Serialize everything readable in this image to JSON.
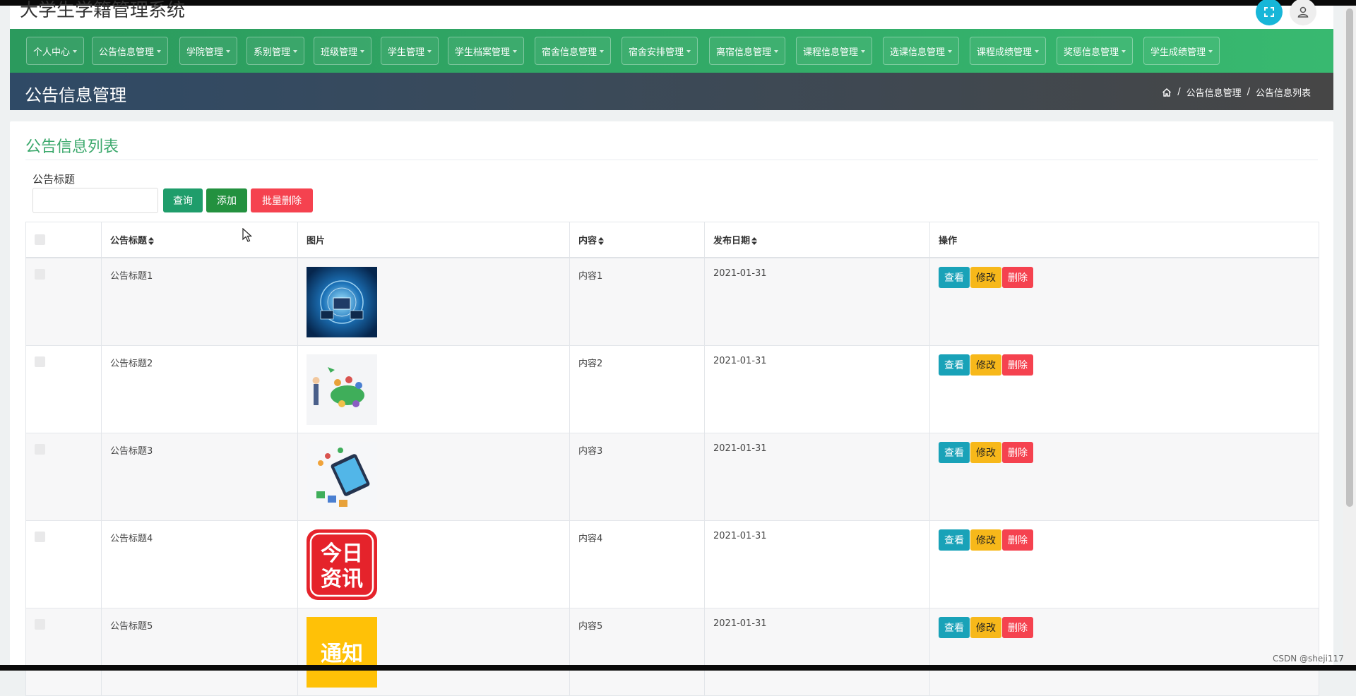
{
  "app": {
    "title": "大学生学籍管理系统"
  },
  "nav": {
    "items": [
      {
        "label": "个人中心"
      },
      {
        "label": "公告信息管理"
      },
      {
        "label": "学院管理"
      },
      {
        "label": "系别管理"
      },
      {
        "label": "班级管理"
      },
      {
        "label": "学生管理"
      },
      {
        "label": "学生档案管理"
      },
      {
        "label": "宿舍信息管理"
      },
      {
        "label": "宿舍安排管理"
      },
      {
        "label": "离宿信息管理"
      },
      {
        "label": "课程信息管理"
      },
      {
        "label": "选课信息管理"
      },
      {
        "label": "课程成绩管理"
      },
      {
        "label": "奖惩信息管理"
      },
      {
        "label": "学生成绩管理"
      }
    ]
  },
  "header": {
    "title": "公告信息管理",
    "breadcrumb": [
      "公告信息管理",
      "公告信息列表"
    ]
  },
  "card": {
    "title": "公告信息列表",
    "search": {
      "label": "公告标题",
      "value": "",
      "placeholder": ""
    },
    "buttons": {
      "query": "查询",
      "add": "添加",
      "batch_delete": "批量删除"
    }
  },
  "table": {
    "columns": [
      "公告标题",
      "图片",
      "内容",
      "发布日期",
      "操作"
    ],
    "rows": [
      {
        "title": "公告标题1",
        "image": "tech-globe-image",
        "content": "内容1",
        "date": "2021-01-31"
      },
      {
        "title": "公告标题2",
        "image": "classroom-illustration",
        "content": "内容2",
        "date": "2021-01-31"
      },
      {
        "title": "公告标题3",
        "image": "online-class-illustration",
        "content": "内容3",
        "date": "2021-01-31"
      },
      {
        "title": "公告标题4",
        "image": "news-app-logo",
        "content": "内容4",
        "date": "2021-01-31"
      },
      {
        "title": "公告标题5",
        "image": "notice-banner",
        "content": "内容5",
        "date": "2021-01-31"
      }
    ],
    "actions": {
      "view": "查看",
      "edit": "修改",
      "delete": "删除"
    }
  },
  "image_text": {
    "news_logo_line1": "今日",
    "news_logo_line2": "资讯",
    "notice": "通知"
  },
  "watermark": "CSDN @sheji117",
  "colors": {
    "nav_green": "#38b970",
    "title_green": "#3aa86b",
    "view": "#19a2b8",
    "edit": "#f7b81a",
    "delete": "#f5424f"
  }
}
